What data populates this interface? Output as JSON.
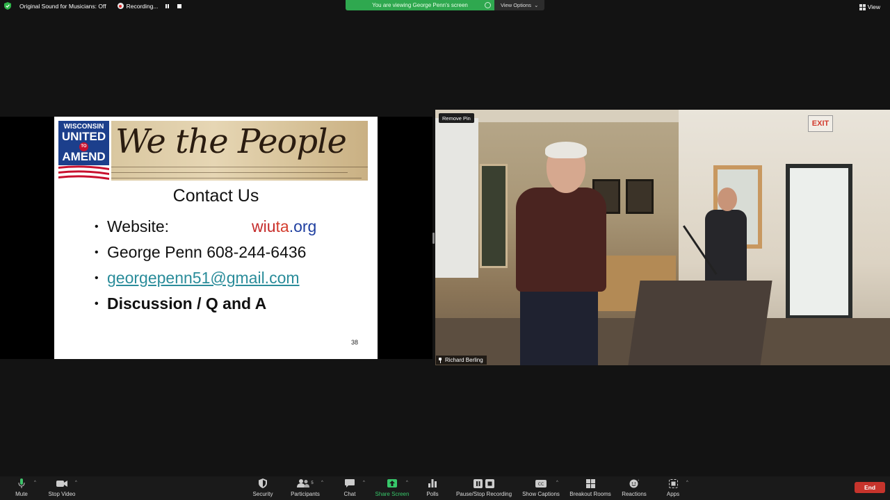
{
  "top_bar": {
    "sound_label": "Original Sound for Musicians: Off",
    "recording_label": "Recording...",
    "viewing_banner": "You are viewing George Penn's screen",
    "view_options_label": "View Options",
    "view_label": "View"
  },
  "slide": {
    "logo_line1": "WISCONSIN",
    "logo_line2": "UNITED",
    "logo_to": "TO",
    "logo_line3": "AMEND",
    "banner_text": "We the People",
    "title": "Contact Us",
    "bullet_website_label": "Website:",
    "url_part1": "wiu",
    "url_part2": "ta",
    "url_part3": ".org",
    "bullet_phone": "George Penn 608-244-6436",
    "bullet_email": "georgepenn51@gmail.com",
    "bullet_discussion": "Discussion / Q and A",
    "page_number": "38"
  },
  "video": {
    "remove_pin_label": "Remove Pin",
    "participant_name": "Richard Berling",
    "exit_sign": "EXIT"
  },
  "toolbar": {
    "mute": "Mute",
    "stop_video": "Stop Video",
    "security": "Security",
    "participants": "Participants",
    "participants_count": "5",
    "chat": "Chat",
    "share_screen": "Share Screen",
    "polls": "Polls",
    "pause_stop_recording": "Pause/Stop Recording",
    "show_captions": "Show Captions",
    "breakout_rooms": "Breakout Rooms",
    "reactions": "Reactions",
    "apps": "Apps",
    "end": "End"
  },
  "colors": {
    "banner_green": "#2fa84f",
    "end_red": "#c6342c",
    "share_green": "#37c86a",
    "email_teal": "#2a8c9a"
  }
}
